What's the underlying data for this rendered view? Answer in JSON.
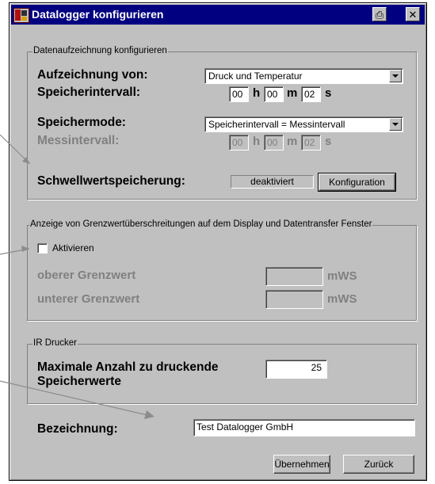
{
  "window": {
    "title": "Datalogger konfigurieren",
    "print_glyph": "⎙",
    "close_glyph": "✕"
  },
  "group1": {
    "legend": "Datenaufzeichnung konfigurieren",
    "recording_label": "Aufzeichnung von:",
    "recording_value": "Druck und Temperatur",
    "storage_interval_label": "Speicherintervall:",
    "storage_interval": {
      "h": "00",
      "m": "00",
      "s": "02"
    },
    "storage_mode_label": "Speichermode:",
    "storage_mode_value": "Speicherintervall = Messintervall",
    "measure_interval_label": "Messintervall:",
    "measure_interval": {
      "h": "00",
      "m": "00",
      "s": "02"
    },
    "threshold_label": "Schwellwertspeicherung:",
    "threshold_status": "deaktiviert",
    "config_button": "Konfiguration",
    "unit_h": "h",
    "unit_m": "m",
    "unit_s": "s"
  },
  "group2": {
    "legend": "Anzeige von Grenzwertüberschreitungen auf dem Display und Datentransfer Fenster",
    "activate_label": "Aktivieren",
    "activate_checked": false,
    "upper_label": "oberer Grenzwert",
    "lower_label": "unterer Grenzwert",
    "upper_value": "",
    "lower_value": "",
    "unit": "mWS"
  },
  "group3": {
    "legend": "IR Drucker",
    "max_label_line1": "Maximale Anzahl zu druckende",
    "max_label_line2": "Speicherwerte",
    "max_value": "25"
  },
  "designation": {
    "label": "Bezeichnung:",
    "value": "Test Datalogger GmbH"
  },
  "buttons": {
    "apply": "Übernehmen",
    "back": "Zurück"
  },
  "colors": {
    "titlebar": "#000080",
    "face": "#c0c0c0",
    "annotation_arrow": "#8c8c8c"
  }
}
